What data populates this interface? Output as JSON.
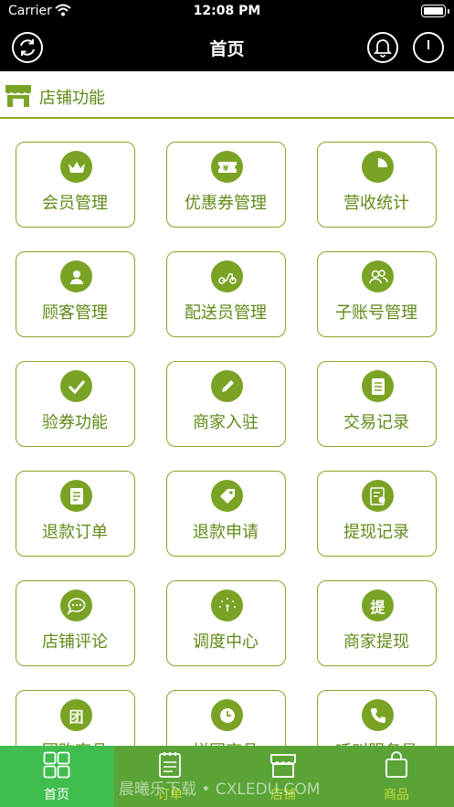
{
  "status_bar": {
    "carrier": "Carrier",
    "time": "12:08 PM"
  },
  "nav": {
    "title": "首页"
  },
  "section": {
    "title": "店铺功能"
  },
  "tiles": [
    {
      "label": "会员管理",
      "icon": "crown-icon"
    },
    {
      "label": "优惠券管理",
      "icon": "coupon-icon"
    },
    {
      "label": "营收统计",
      "icon": "pie-chart-icon"
    },
    {
      "label": "顾客管理",
      "icon": "person-icon"
    },
    {
      "label": "配送员管理",
      "icon": "scooter-icon"
    },
    {
      "label": "子账号管理",
      "icon": "users-icon"
    },
    {
      "label": "验券功能",
      "icon": "check-icon"
    },
    {
      "label": "商家入驻",
      "icon": "pencil-icon"
    },
    {
      "label": "交易记录",
      "icon": "list-icon"
    },
    {
      "label": "退款订单",
      "icon": "document-icon"
    },
    {
      "label": "退款申请",
      "icon": "tag-icon"
    },
    {
      "label": "提现记录",
      "icon": "receipt-icon"
    },
    {
      "label": "店铺评论",
      "icon": "chat-icon"
    },
    {
      "label": "调度中心",
      "icon": "dial-icon"
    },
    {
      "label": "商家提现",
      "icon": "withdraw-icon",
      "glyph": "提"
    },
    {
      "label": "团购商品",
      "icon": "group-buy-icon",
      "glyph": "团"
    },
    {
      "label": "拼团商品",
      "icon": "clock-icon"
    },
    {
      "label": "呼叫服务员",
      "icon": "phone-icon"
    }
  ],
  "tabs": [
    {
      "label": "首页",
      "icon": "grid-icon",
      "active": true
    },
    {
      "label": "订单",
      "icon": "notepad-icon",
      "active": false
    },
    {
      "label": "店铺",
      "icon": "store-icon",
      "active": false
    },
    {
      "label": "商品",
      "icon": "bag-icon",
      "active": false
    }
  ],
  "watermark": "晨曦乐下载 • CXLEDU.COM",
  "colors": {
    "accent": "#7aa325",
    "text_green": "#5f8a18",
    "tab_bar": "#5aa437",
    "tab_active": "#3fbe4e"
  }
}
